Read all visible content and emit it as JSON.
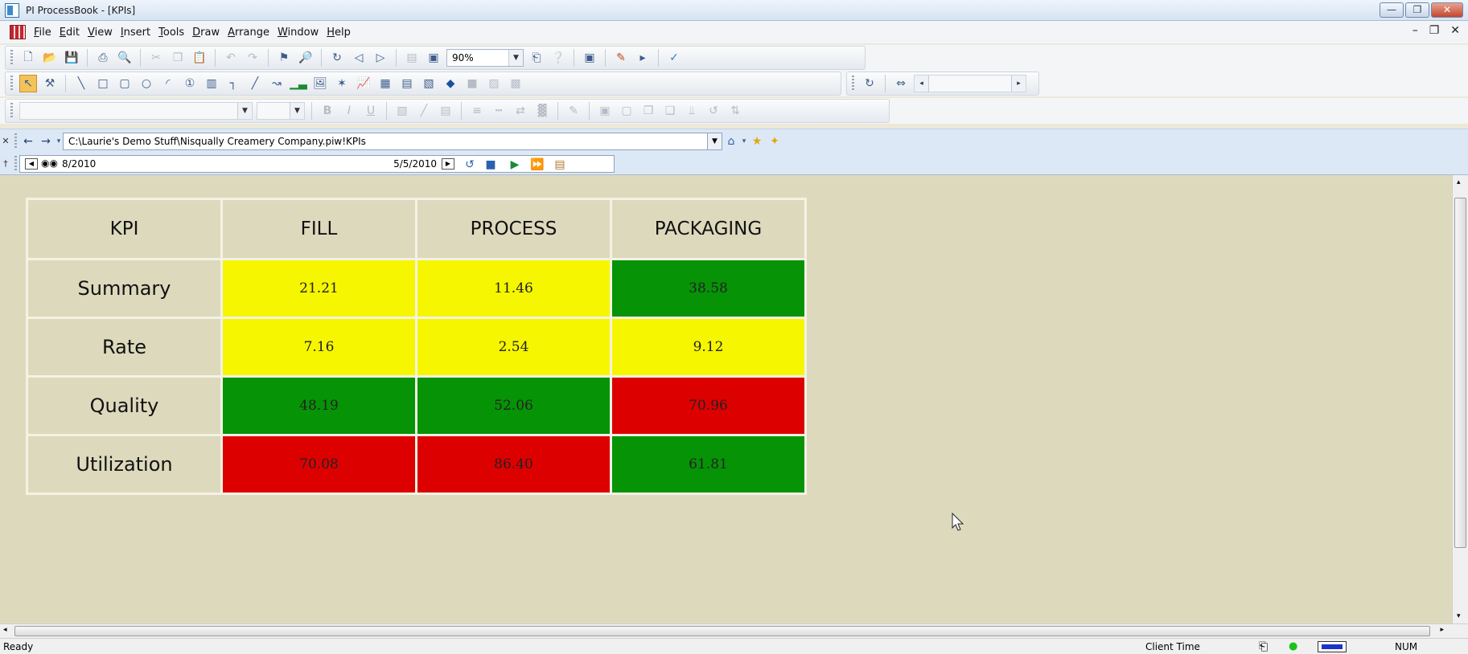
{
  "window": {
    "title": "PI ProcessBook - [KPIs]"
  },
  "menu": [
    "File",
    "Edit",
    "View",
    "Insert",
    "Tools",
    "Draw",
    "Arrange",
    "Window",
    "Help"
  ],
  "toolbar": {
    "zoom": "90%"
  },
  "nav": {
    "path": "C:\\Laurie's Demo Stuff\\Nisqually Creamery Company.piw!KPIs",
    "start_time": "8/2010",
    "end_time": "5/5/2010"
  },
  "kpi_table": {
    "headers": [
      "KPI",
      "FILL",
      "PROCESS",
      "PACKAGING"
    ],
    "rows": [
      {
        "label": "Summary",
        "values": [
          "21.21",
          "11.46",
          "38.58"
        ],
        "status": [
          "yellow",
          "yellow",
          "green"
        ]
      },
      {
        "label": "Rate",
        "values": [
          "7.16",
          "2.54",
          "9.12"
        ],
        "status": [
          "yellow",
          "yellow",
          "yellow"
        ]
      },
      {
        "label": "Quality",
        "values": [
          "48.19",
          "52.06",
          "70.96"
        ],
        "status": [
          "green",
          "green",
          "red"
        ]
      },
      {
        "label": "Utilization",
        "values": [
          "70.08",
          "86.40",
          "61.81"
        ],
        "status": [
          "red",
          "red",
          "green"
        ]
      }
    ]
  },
  "colors": {
    "yellow": "#f6f600",
    "green": "#069306",
    "red": "#dd0000",
    "workspace": "#ddd9bd"
  },
  "status": {
    "left": "Ready",
    "time_mode": "Client Time",
    "num": "NUM"
  }
}
